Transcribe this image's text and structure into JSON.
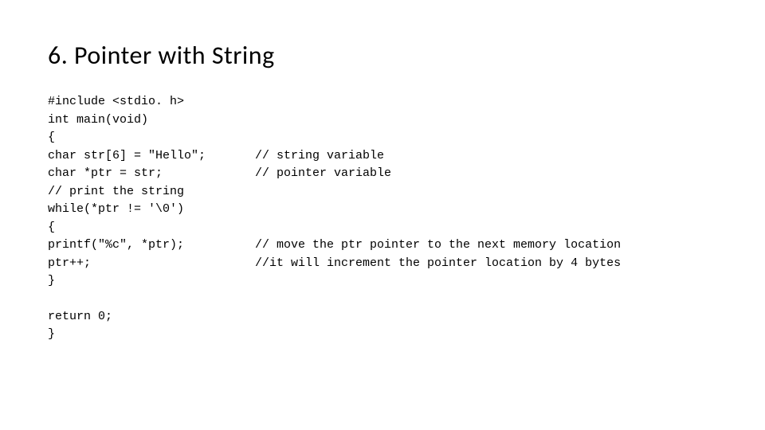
{
  "title": "6. Pointer with String",
  "code": {
    "line01_left": "#include <stdio. h>",
    "line02_left": "int main(void)",
    "line03_left": "{",
    "line04_left": "char str[6] = \"Hello\";",
    "line04_right": "// string variable",
    "line05_left": "char *ptr = str;",
    "line05_right": "// pointer variable",
    "line06_left": "// print the string",
    "line07_left": "while(*ptr != '\\0')",
    "line08_left": "{",
    "line09_left": "printf(\"%c\", *ptr);",
    "line09_right": "// move the ptr pointer to the next memory location",
    "line10_left": "ptr++;",
    "line10_right": "//it will increment the pointer location by 4 bytes",
    "line11_left": "}",
    "line12_left": "return 0;",
    "line13_left": "}"
  }
}
